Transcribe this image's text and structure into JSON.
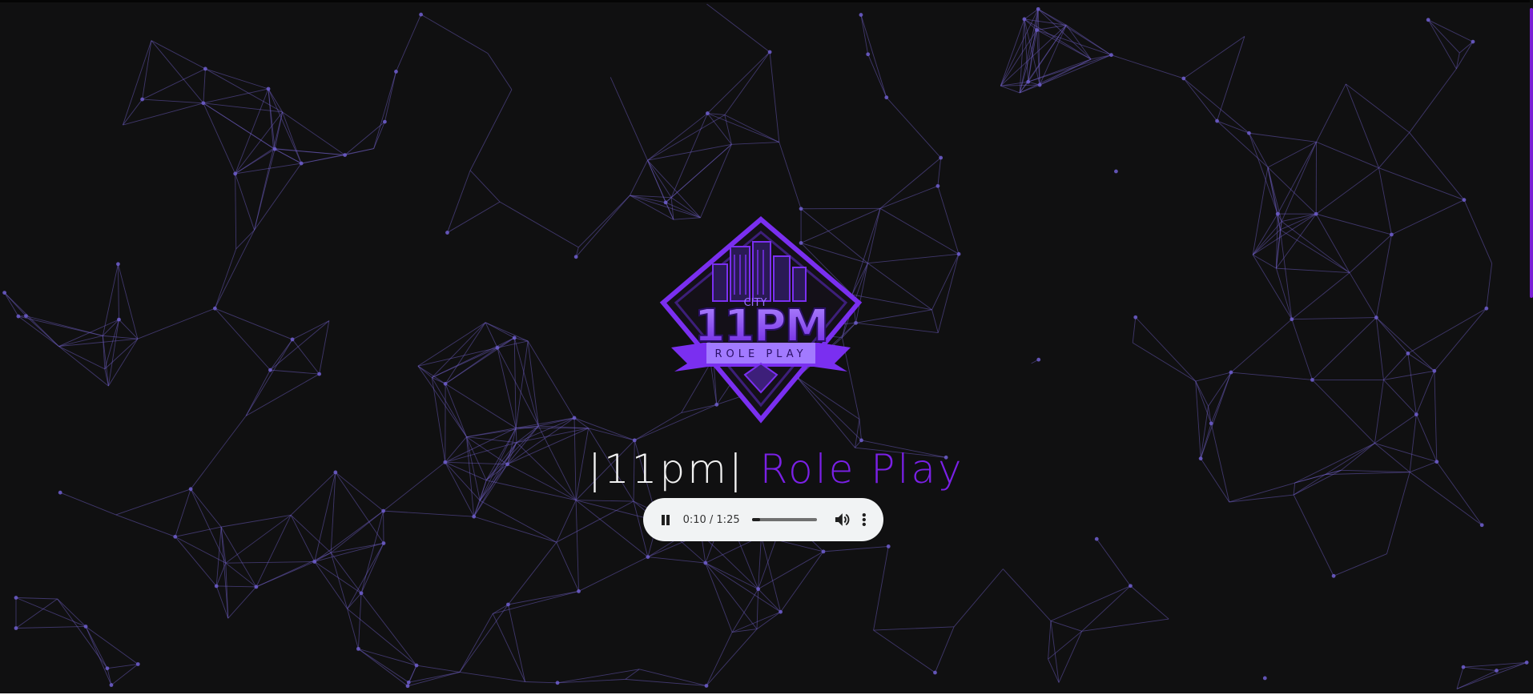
{
  "hero": {
    "title_plain": "|11pm|",
    "title_accent": "Role Play"
  },
  "logo": {
    "top_text": "CITY",
    "main_text": "11PM",
    "banner_text": "ROLE PLAY",
    "accent_color": "#7a2ff0"
  },
  "audio_player": {
    "time": "0:10 / 1:25",
    "progress": 0.12,
    "state": "playing",
    "icons": [
      "pause-icon",
      "volume-icon",
      "more-options-icon"
    ]
  },
  "colors": {
    "background": "#101011",
    "network": "#6a5bc6",
    "accent": "#7a20e6",
    "scrollbar_thumb": "#7a1fd6"
  }
}
